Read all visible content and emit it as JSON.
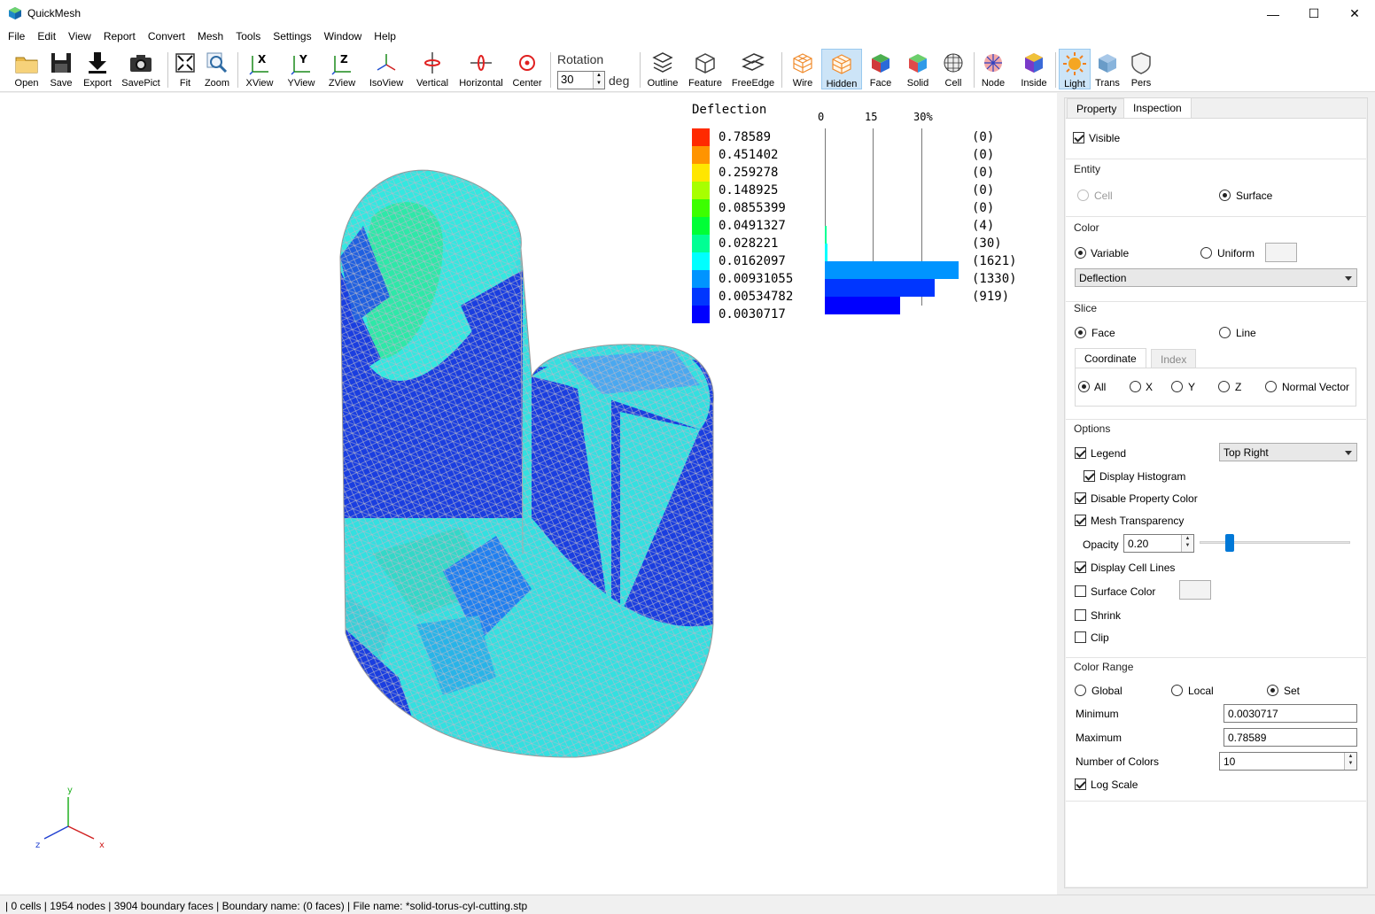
{
  "window": {
    "title": "QuickMesh",
    "controls": {
      "minimize": "—",
      "maximize": "☐",
      "close": "✕"
    }
  },
  "menu": [
    "File",
    "Edit",
    "View",
    "Report",
    "Convert",
    "Mesh",
    "Tools",
    "Settings",
    "Window",
    "Help"
  ],
  "toolbar": {
    "buttons": [
      {
        "label": "Open",
        "icon": "folder-icon"
      },
      {
        "label": "Save",
        "icon": "floppy-icon"
      },
      {
        "label": "Export",
        "icon": "download-arrow-icon"
      },
      {
        "label": "SavePict",
        "icon": "camera-icon"
      },
      {
        "label": "Fit",
        "icon": "fit-arrows-icon"
      },
      {
        "label": "Zoom",
        "icon": "magnifier-icon"
      },
      {
        "label": "XView",
        "icon": "x-axis-view-icon",
        "letter": "X"
      },
      {
        "label": "YView",
        "icon": "y-axis-view-icon",
        "letter": "Y"
      },
      {
        "label": "ZView",
        "icon": "z-axis-view-icon",
        "letter": "Z"
      },
      {
        "label": "IsoView",
        "icon": "iso-axes-icon"
      },
      {
        "label": "Vertical",
        "icon": "vertical-rotate-icon"
      },
      {
        "label": "Horizontal",
        "icon": "horizontal-rotate-icon"
      },
      {
        "label": "Center",
        "icon": "center-target-icon"
      },
      {
        "label": "Outline",
        "icon": "layers-outline-icon"
      },
      {
        "label": "Feature",
        "icon": "wire-cube-icon"
      },
      {
        "label": "FreeEdge",
        "icon": "free-edge-icon"
      },
      {
        "label": "Wire",
        "icon": "wire-mesh-cube-icon"
      },
      {
        "label": "Hidden",
        "icon": "hidden-line-cube-icon"
      },
      {
        "label": "Face",
        "icon": "face-cube-icon"
      },
      {
        "label": "Solid",
        "icon": "solid-cube-icon"
      },
      {
        "label": "Cell",
        "icon": "cell-sphere-icon"
      },
      {
        "label": "Node",
        "icon": "node-grid-icon"
      },
      {
        "label": "Inside",
        "icon": "inside-hexagon-icon"
      },
      {
        "label": "Light",
        "icon": "sun-light-icon"
      },
      {
        "label": "Trans",
        "icon": "transparent-cube-icon"
      },
      {
        "label": "Pers",
        "icon": "perspective-shield-icon"
      }
    ],
    "rotation": {
      "label": "Rotation",
      "value": "30",
      "unit": "deg"
    }
  },
  "legend": {
    "title": "Deflection",
    "colors": [
      "#ff2a00",
      "#ff9400",
      "#ffe600",
      "#a8ff00",
      "#3cff00",
      "#00ff36",
      "#00ff94",
      "#00ffff",
      "#0094ff",
      "#0036ff",
      "#0000ff"
    ],
    "values": [
      "0.78589",
      "0.451402",
      "0.259278",
      "0.148925",
      "0.0855399",
      "0.0491327",
      "0.028221",
      "0.0162097",
      "0.00931055",
      "0.00534782",
      "0.0030717"
    ],
    "counts": [
      "(0)",
      "(0)",
      "(0)",
      "(0)",
      "(0)",
      "(4)",
      "(30)",
      "(1621)",
      "(1330)",
      "(919)"
    ],
    "histogram_ticks": [
      "0",
      "15",
      "30%"
    ],
    "histogram_fractions": [
      0,
      0,
      0,
      0,
      0,
      0.00103,
      0.0077,
      0.4151,
      0.3406,
      0.2353
    ]
  },
  "triad": {
    "x": "x",
    "y": "y",
    "z": "z"
  },
  "panel": {
    "tabs": [
      "Property",
      "Inspection"
    ],
    "visible": {
      "label": "Visible",
      "checked": true
    },
    "entity": {
      "title": "Entity",
      "cell": "Cell",
      "surface": "Surface"
    },
    "color": {
      "title": "Color",
      "variable": "Variable",
      "uniform": "Uniform",
      "selected": "Deflection"
    },
    "slice": {
      "title": "Slice",
      "face": "Face",
      "line": "Line",
      "subtabs": [
        "Coordinate",
        "Index"
      ],
      "all": "All",
      "x": "X",
      "y": "Y",
      "z": "Z",
      "normal": "Normal Vector"
    },
    "options": {
      "title": "Options",
      "legend": "Legend",
      "legend_position": "Top Right",
      "display_histogram": "Display Histogram",
      "disable_property_color": "Disable Property Color",
      "mesh_transparency": "Mesh Transparency",
      "opacity_label": "Opacity",
      "opacity_value": "0.20",
      "opacity_fraction": 0.2,
      "display_cell_lines": "Display Cell Lines",
      "surface_color": "Surface Color",
      "shrink": "Shrink",
      "clip": "Clip"
    },
    "color_range": {
      "title": "Color Range",
      "global": "Global",
      "local": "Local",
      "set": "Set",
      "minimum_label": "Minimum",
      "minimum": "0.0030717",
      "maximum_label": "Maximum",
      "maximum": "0.78589",
      "num_colors_label": "Number of Colors",
      "num_colors": "10",
      "log_scale": "Log Scale"
    }
  },
  "status": "| 0 cells | 1954 nodes | 3904 boundary faces |  Boundary name:  (0 faces) | File name: *solid-torus-cyl-cutting.stp"
}
